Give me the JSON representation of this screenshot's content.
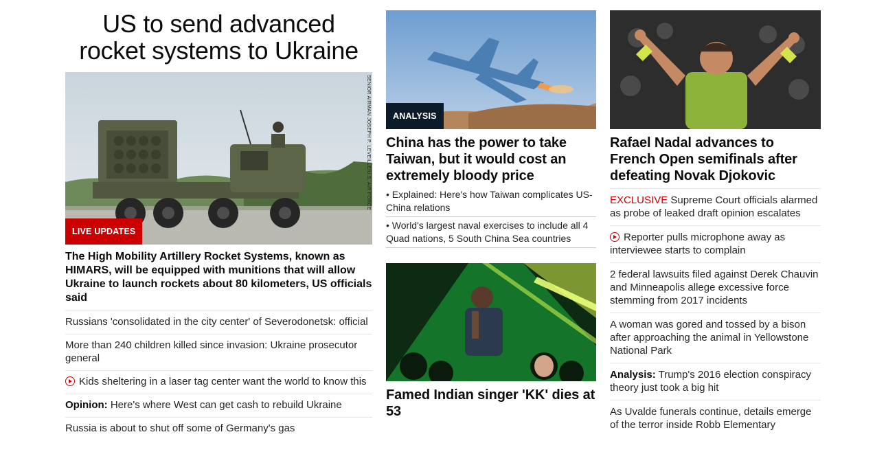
{
  "lead": {
    "title_line1": "US to send advanced",
    "title_line2": "rocket systems to Ukraine",
    "image_credit": "SENIOR AIRMAN JOSEPH P. LEVEILLE/U.S. AIR FORCE",
    "badge": "LIVE UPDATES",
    "summary": "The High Mobility Artillery Rocket Systems, known as HIMARS, will be equipped with munitions that will allow Ukraine to launch rockets about 80 kilometers, US officials said",
    "items": [
      {
        "text": "Russians 'consolidated in the city center' of Severodonetsk: official"
      },
      {
        "text": "More than 240 children killed since invasion: Ukraine prosecutor general"
      },
      {
        "text": "Kids sheltering in a laser tag center want the world to know this",
        "video": true
      },
      {
        "prefix": "Opinion:",
        "text": " Here's where West can get cash to rebuild Ukraine"
      },
      {
        "text": "Russia is about to shut off some of Germany's gas"
      }
    ]
  },
  "china": {
    "badge": "ANALYSIS",
    "headline": "China has the power to take Taiwan, but it would cost an extremely bloody price",
    "bullets": [
      "• Explained: Here's how Taiwan complicates US-China relations",
      "• World's largest naval exercises to include all 4 Quad nations, 5 South China Sea countries"
    ]
  },
  "kk": {
    "headline": "Famed Indian singer 'KK' dies at 53"
  },
  "nadal": {
    "headline": "Rafael Nadal advances to French Open semifinals after defeating Novak Djokovic",
    "items": [
      {
        "exclusive": "EXCLUSIVE",
        "text": " Supreme Court officials alarmed as probe of leaked draft opinion escalates"
      },
      {
        "text": "Reporter pulls microphone away as interviewee starts to complain",
        "video": true
      },
      {
        "text": "2 federal lawsuits filed against Derek Chauvin and Minneapolis allege excessive force stemming from 2017 incidents"
      },
      {
        "text": "A woman was gored and tossed by a bison after approaching the animal in Yellowstone National Park"
      },
      {
        "prefix": "Analysis:",
        "text": " Trump's 2016 election conspiracy theory just took a big hit"
      },
      {
        "text": "As Uvalde funerals continue, details emerge of the terror inside Robb Elementary"
      }
    ]
  },
  "colors": {
    "live_red": "#cc0000",
    "analysis_navy": "#0c1b2a",
    "divider": "#e6e6e6"
  }
}
